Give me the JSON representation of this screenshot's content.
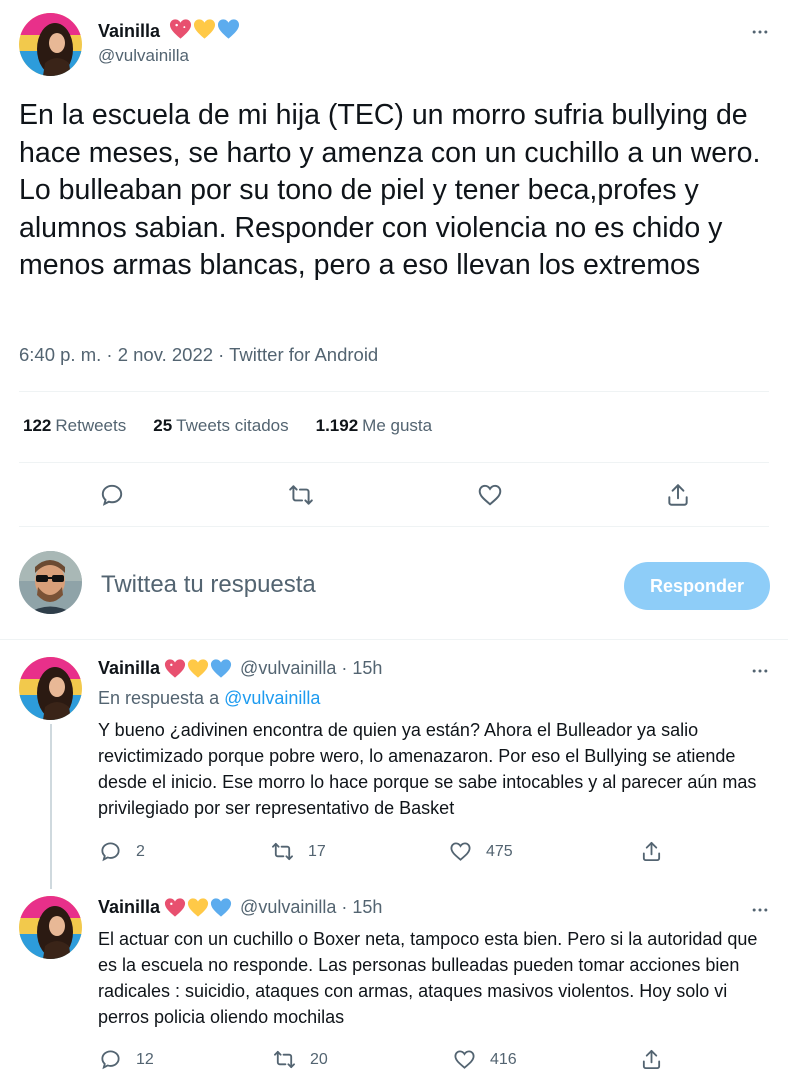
{
  "main_tweet": {
    "name": "Vainilla",
    "handle": "@vulvainilla",
    "text": "En la escuela de mi hija (TEC) un morro sufria bullying de hace meses, se harto y amenza con un cuchillo a un wero. Lo bulleaban por su tono de piel y tener beca,profes y alumnos sabian. Responder con violencia no es chido y menos armas blancas, pero a eso llevan los extremos",
    "meta": "6:40 p. m. · 2 nov. 2022 · Twitter for Android",
    "stats": {
      "retweets_count": "122",
      "retweets_label": "Retweets",
      "quotes_count": "25",
      "quotes_label": "Tweets citados",
      "likes_count": "1.192",
      "likes_label": "Me gusta"
    }
  },
  "compose": {
    "placeholder": "Twittea tu respuesta",
    "button_label": "Responder"
  },
  "replies": [
    {
      "name": "Vainilla",
      "handle": "@vulvainilla · 15h",
      "in_reply_prefix": "En respuesta a",
      "in_reply_handle": "@vulvainilla",
      "text": "Y bueno ¿adivinen encontra de quien ya están? Ahora el Bulleador ya salio revictimizado porque pobre wero, lo amenazaron. Por eso el Bullying se atiende desde el inicio. Ese morro lo hace porque se sabe intocables y al parecer aún mas privilegiado por ser representativo de Basket",
      "replies": "2",
      "retweets": "17",
      "likes": "475"
    },
    {
      "name": "Vainilla",
      "handle": "@vulvainilla · 15h",
      "text": "El actuar con un cuchillo o Boxer neta, tampoco esta bien. Pero si la autoridad que es la escuela no responde. Las personas bulleadas pueden tomar acciones bien radicales : suicidio, ataques con armas, ataques masivos violentos. Hoy solo vi perros policia oliendo mochilas",
      "replies": "12",
      "retweets": "20",
      "likes": "416"
    }
  ],
  "icons": {
    "heart_pink": "#e8506f",
    "heart_yellow": "#ffc947",
    "heart_blue": "#5cacee",
    "icon_gray": "#536471",
    "accent": "#1d9bf0"
  }
}
